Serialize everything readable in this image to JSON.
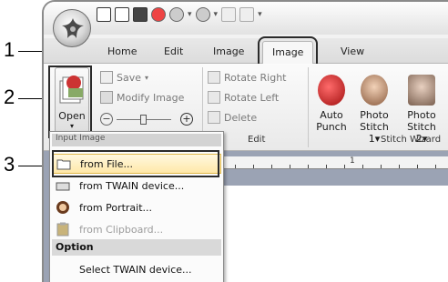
{
  "callouts": {
    "one": "1",
    "two": "2",
    "three": "3"
  },
  "tabs": {
    "home": "Home",
    "edit": "Edit",
    "image": "Image",
    "view": "View"
  },
  "ribbon": {
    "open_label": "Open",
    "save_label": "Save",
    "modify_image_label": "Modify Image",
    "rotate_right_label": "Rotate Right",
    "rotate_left_label": "Rotate Left",
    "delete_label": "Delete",
    "edit_group_label": "Edit",
    "auto_punch_label": "Auto\nPunch",
    "photo1_label": "Photo\nStitch 1",
    "photo2_label": "Photo\nStitch 2",
    "stitch_wizard_group": "Stitch Wizard"
  },
  "ruler": {
    "mark1": "2",
    "mark2": "1"
  },
  "menu": {
    "header": "Input Image",
    "from_file": "from File...",
    "from_twain": "from TWAIN device...",
    "from_portrait": "from Portrait...",
    "from_clipboard": "from Clipboard...",
    "option_header": "Option",
    "select_twain": "Select TWAIN device..."
  },
  "colors": {
    "accent_hover": "#ffe8a8",
    "workspace": "#9ba3b4",
    "callout_frame": "#2a2a2a"
  }
}
